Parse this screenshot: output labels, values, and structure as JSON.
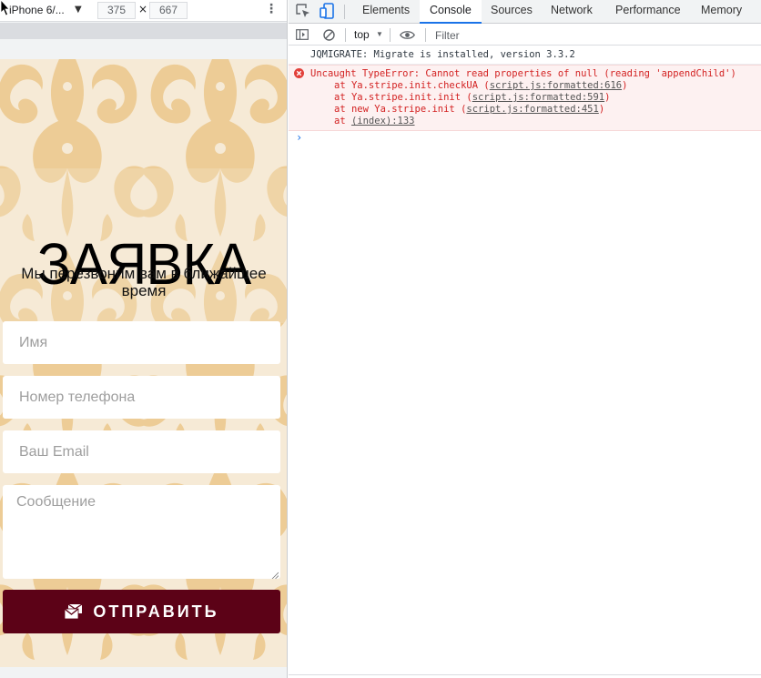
{
  "device_toolbar": {
    "device_name": "iPhone 6/...",
    "width": "375",
    "times": "×",
    "height": "667"
  },
  "form": {
    "title": "ЗАЯВКА",
    "subtitle": "Мы перезвоним вам в ближайшее время",
    "name_placeholder": "Имя",
    "phone_placeholder": "Номер телефона",
    "email_placeholder": "Ваш Email",
    "message_placeholder": "Сообщение",
    "submit_label": "ОТПРАВИТЬ",
    "submit_color": "#5c0217",
    "background_color": "#f6ead6",
    "pattern_color": "#eccb94"
  },
  "devtools": {
    "tabs": [
      {
        "label": "Elements"
      },
      {
        "label": "Console"
      },
      {
        "label": "Sources"
      },
      {
        "label": "Network"
      },
      {
        "label": "Performance"
      },
      {
        "label": "Memory"
      }
    ],
    "active_tab": "Console",
    "context": "top",
    "filter_placeholder": "Filter",
    "logs": [
      {
        "type": "info",
        "text": "JQMIGRATE: Migrate is installed, version 3.3.2"
      },
      {
        "type": "error",
        "text": "Uncaught TypeError: Cannot read properties of null (reading 'appendChild')",
        "trace": [
          {
            "prefix": "at Ya.stripe.init.checkUA (",
            "link": "script.js:formatted:616",
            "suffix": ")"
          },
          {
            "prefix": "at Ya.stripe.init.init (",
            "link": "script.js:formatted:591",
            "suffix": ")"
          },
          {
            "prefix": "at new Ya.stripe.init (",
            "link": "script.js:formatted:451",
            "suffix": ")"
          },
          {
            "prefix": "at ",
            "link": "(index):133",
            "suffix": ""
          }
        ]
      }
    ],
    "prompt": "›"
  }
}
